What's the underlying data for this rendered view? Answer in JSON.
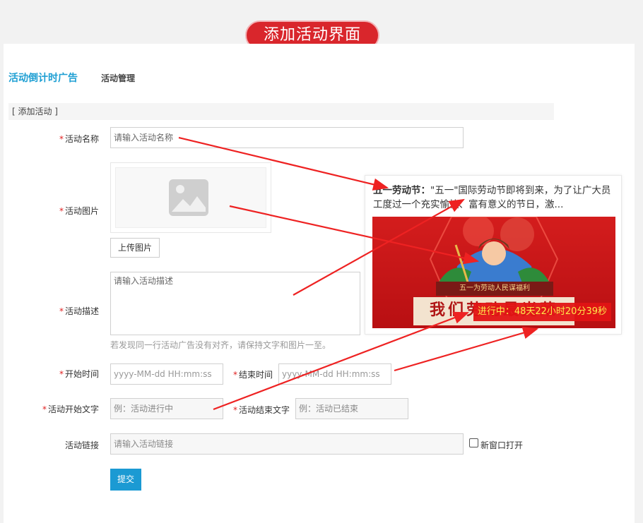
{
  "banner": {
    "title": "添加活动界面"
  },
  "tabs": [
    {
      "label": "活动倒计时广告",
      "active": true
    },
    {
      "label": "活动管理",
      "active": false
    }
  ],
  "section": {
    "title": "[ 添加活动 ]"
  },
  "form": {
    "required_mark": "*",
    "name": {
      "label": "活动名称",
      "placeholder": "请输入活动名称"
    },
    "image": {
      "label": "活动图片",
      "upload_label": "上传图片"
    },
    "description": {
      "label": "活动描述",
      "placeholder": "请输入活动描述",
      "hint": "若发现同一行活动广告没有对齐，请保持文字和图片一至。"
    },
    "start_time": {
      "label": "开始时间",
      "placeholder": "yyyy-MM-dd HH:mm:ss"
    },
    "end_time": {
      "label": "结束时间",
      "placeholder": "yyyy-MM-dd HH:mm:ss"
    },
    "start_text": {
      "label": "活动开始文字",
      "placeholder": "例：活动进行中"
    },
    "end_text": {
      "label": "活动结束文字",
      "placeholder": "例：活动已结束"
    },
    "link": {
      "label": "活动链接",
      "placeholder": "请输入活动链接",
      "new_window_label": "新窗口打开",
      "new_window_checked": false
    },
    "submit_label": "提交"
  },
  "preview": {
    "title": "五一劳动节：",
    "body": "\"五一\"国际劳动节即将到来，为了让广大员工度过一个充实愉快、富有意义的节日，激...",
    "poster_caption": "五一为劳动人民谋福利",
    "poster_slogan": "我们劳动最光荣",
    "countdown": "进行中：48天22小时20分39秒"
  },
  "colors": {
    "accent": "#1e9fd3",
    "banner": "#d9262c",
    "required": "#e02020",
    "arrow": "#ee2222"
  }
}
